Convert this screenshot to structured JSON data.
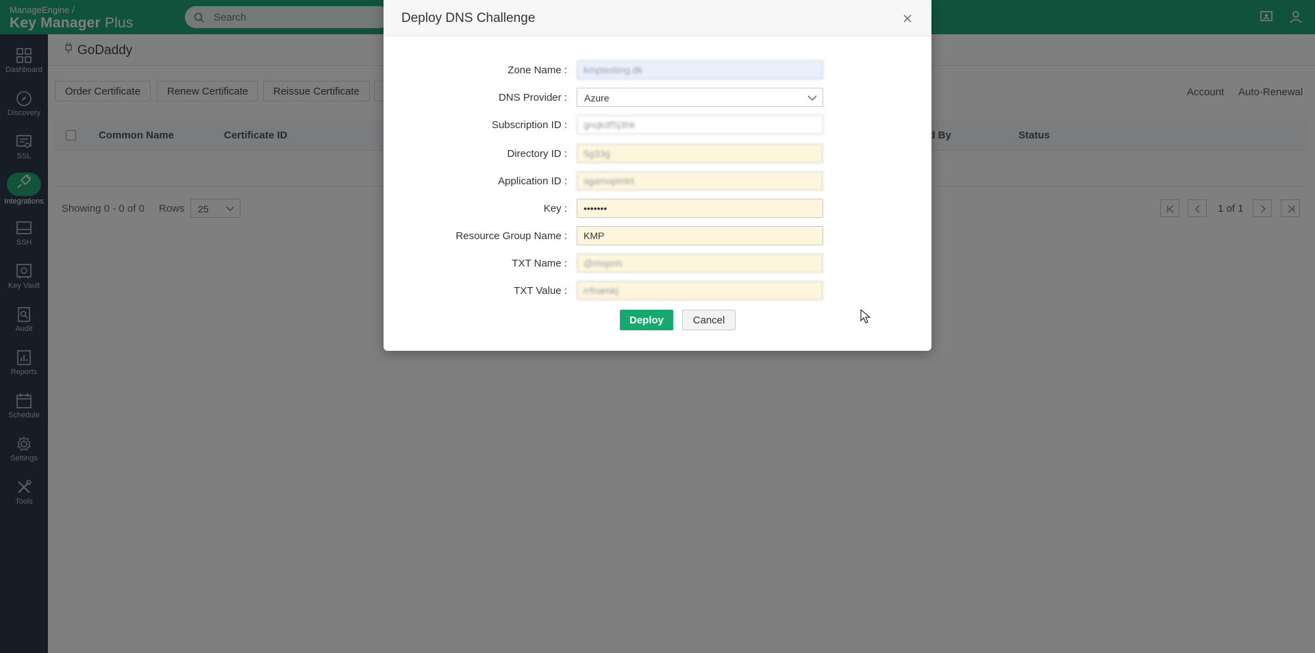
{
  "brand": {
    "top": "ManageEngine",
    "main": "Key Manager",
    "suffix": " Plus"
  },
  "search": {
    "placeholder": "Search"
  },
  "sidebar": {
    "items": [
      {
        "label": "Dashboard",
        "icon": "dashboard-icon"
      },
      {
        "label": "Discovery",
        "icon": "compass-icon"
      },
      {
        "label": "SSL",
        "icon": "certificate-icon"
      },
      {
        "label": "Integrations",
        "icon": "plug-icon",
        "active": true
      },
      {
        "label": "SSH",
        "icon": "terminal-icon"
      },
      {
        "label": "Key Vault",
        "icon": "vault-icon"
      },
      {
        "label": "Audit",
        "icon": "audit-icon"
      },
      {
        "label": "Reports",
        "icon": "reports-icon"
      },
      {
        "label": "Schedule",
        "icon": "calendar-icon"
      },
      {
        "label": "Settings",
        "icon": "gear-icon"
      },
      {
        "label": "Tools",
        "icon": "tools-icon"
      }
    ]
  },
  "page": {
    "title": "GoDaddy"
  },
  "toolbar": {
    "order": "Order Certificate",
    "renew": "Renew Certificate",
    "reissue": "Reissue Certificate",
    "account": "Account",
    "autorenewal": "Auto-Renewal"
  },
  "table": {
    "headers": [
      "Common Name",
      "Certificate ID",
      "ed By",
      "Status"
    ]
  },
  "pager": {
    "showing": "Showing 0 - 0 of 0",
    "rows_label": "Rows",
    "rows_value": "25",
    "page_text": "1 of 1"
  },
  "modal": {
    "title": "Deploy DNS Challenge",
    "fields": [
      {
        "label": "Zone Name",
        "value": "kmptesting.dk"
      },
      {
        "label": "DNS Provider",
        "value": "Azure"
      },
      {
        "label": "Subscription ID",
        "value": "gnqkdf5j3hk"
      },
      {
        "label": "Directory ID",
        "value": "5g33g"
      },
      {
        "label": "Application ID",
        "value": "sgamopmtrt"
      },
      {
        "label": "Key",
        "value": "•••••••"
      },
      {
        "label": "Resource Group Name",
        "value": "KMP"
      },
      {
        "label": "TXT Name",
        "value": "@mspnh"
      },
      {
        "label": "TXT Value",
        "value": "rrfnamkj"
      }
    ],
    "deploy": "Deploy",
    "cancel": "Cancel"
  },
  "colors": {
    "topbar": "#20a779",
    "sidebar": "#2f3b48",
    "deploy_button": "#16a96e",
    "autofill": "#fdf6dc"
  }
}
